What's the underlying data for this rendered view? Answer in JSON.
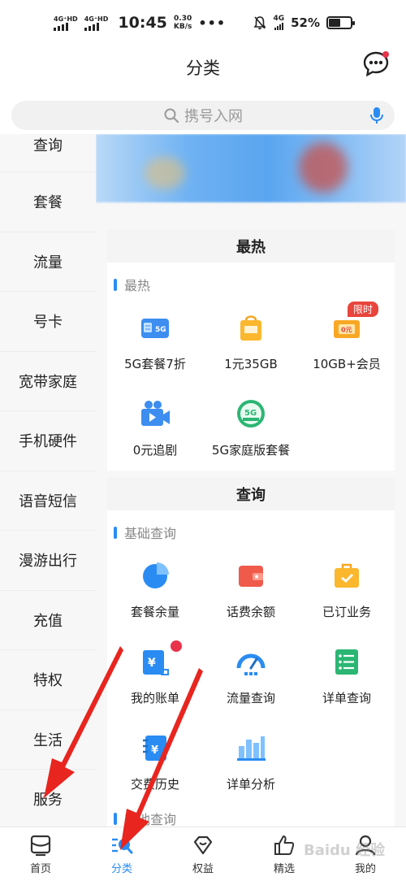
{
  "status_bar": {
    "net1": "4G⁺HD",
    "net2": "4G⁺HD",
    "time": "10:45",
    "speed_value": "0.30",
    "speed_unit": "KB/s",
    "more": "•••",
    "net_right": "4G",
    "battery": "52%",
    "battery_level": 0.52
  },
  "header": {
    "title": "分类"
  },
  "search": {
    "placeholder": "携号入网"
  },
  "sidebar": {
    "items": [
      {
        "label": "查询"
      },
      {
        "label": "套餐"
      },
      {
        "label": "流量"
      },
      {
        "label": "号卡"
      },
      {
        "label": "宽带家庭"
      },
      {
        "label": "手机硬件"
      },
      {
        "label": "语音短信"
      },
      {
        "label": "漫游出行"
      },
      {
        "label": "充值"
      },
      {
        "label": "特权"
      },
      {
        "label": "生活"
      },
      {
        "label": "服务"
      }
    ]
  },
  "sections": {
    "hot": {
      "title": "最热",
      "group": "最热",
      "items": [
        {
          "label": "5G套餐7折",
          "icon": "5g-sim-icon"
        },
        {
          "label": "1元35GB",
          "icon": "shopping-bag-icon"
        },
        {
          "label": "10GB+会员",
          "icon": "coupon-icon",
          "tag": "限时"
        },
        {
          "label": "0元追剧",
          "icon": "video-camera-icon"
        },
        {
          "label": "5G家庭版套餐",
          "icon": "5g-home-icon"
        }
      ]
    },
    "query": {
      "title": "查询",
      "group": "基础查询",
      "items": [
        {
          "label": "套餐余量",
          "icon": "pie-chart-icon"
        },
        {
          "label": "话费余额",
          "icon": "wallet-icon"
        },
        {
          "label": "已订业务",
          "icon": "briefcase-check-icon"
        },
        {
          "label": "我的账单",
          "icon": "bill-icon"
        },
        {
          "label": "流量查询",
          "icon": "speedometer-icon"
        },
        {
          "label": "详单查询",
          "icon": "list-icon"
        },
        {
          "label": "交费历史",
          "icon": "payment-history-icon"
        },
        {
          "label": "详单分析",
          "icon": "bar-chart-icon"
        }
      ],
      "group2": "其他查询"
    }
  },
  "tabbar": {
    "tabs": [
      {
        "label": "首页"
      },
      {
        "label": "分类"
      },
      {
        "label": "权益"
      },
      {
        "label": "精选"
      },
      {
        "label": "我的"
      }
    ]
  },
  "watermark": "Baidu 经验"
}
